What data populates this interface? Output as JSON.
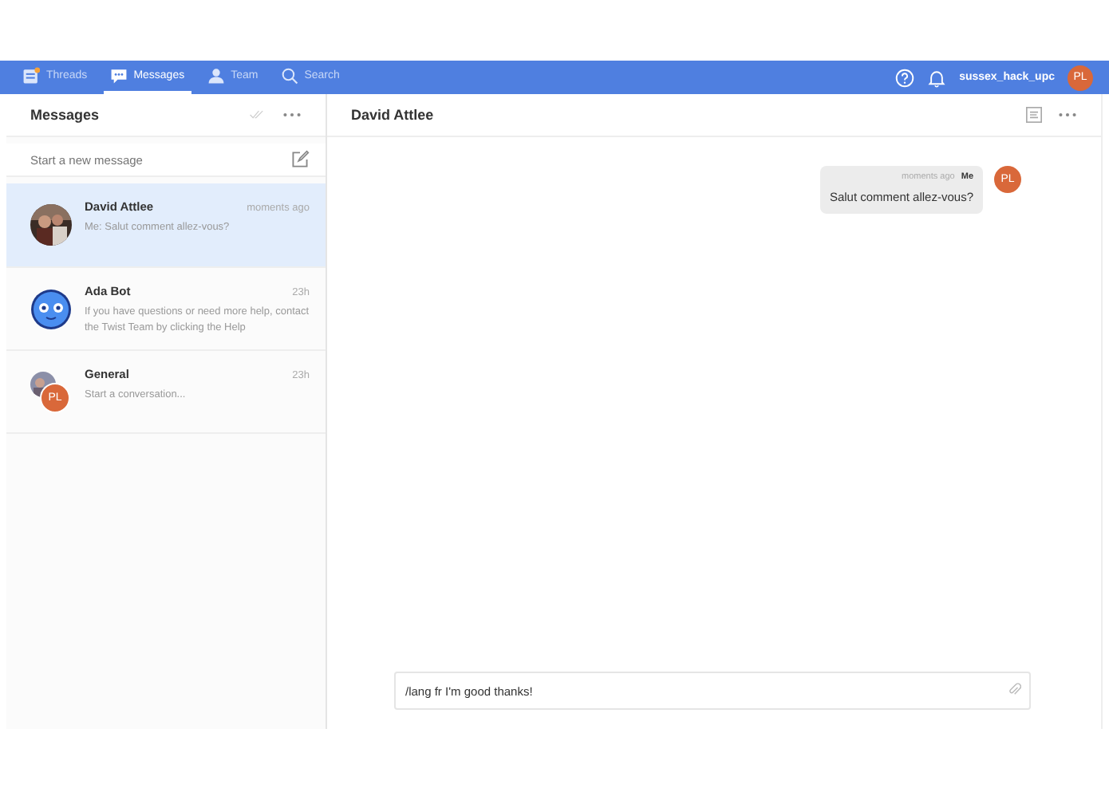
{
  "nav": {
    "tabs": [
      {
        "label": "Threads",
        "selected": false,
        "kind": "threads"
      },
      {
        "label": "Messages",
        "selected": true,
        "kind": "messages"
      },
      {
        "label": "Team",
        "selected": false,
        "kind": "team"
      },
      {
        "label": "Search",
        "selected": false,
        "kind": "search"
      }
    ],
    "username": "sussex_hack_upc",
    "avatar": "PL"
  },
  "sidebar": {
    "title": "Messages",
    "new_message": {
      "placeholder": "Start a new message"
    },
    "conversations": [
      {
        "name": "David Attlee",
        "time": "moments ago",
        "preview": "Me: Salut comment allez-vous?",
        "selected": true
      },
      {
        "name": "Ada Bot",
        "time": "23h",
        "preview": "If you have questions or need more help, contact the Twist Team by clicking the Help",
        "selected": false,
        "kind": "bot"
      },
      {
        "name": "General",
        "time": "23h",
        "preview": "Start a conversation...",
        "selected": false,
        "kind": "group",
        "avatar": "PL"
      }
    ]
  },
  "chat": {
    "title": "David Attlee",
    "messages": [
      {
        "time": "moments ago",
        "author": "Me",
        "text": "Salut comment allez-vous?",
        "avatar": "PL"
      }
    ],
    "composer": {
      "value": "/lang fr I'm good thanks!"
    }
  }
}
